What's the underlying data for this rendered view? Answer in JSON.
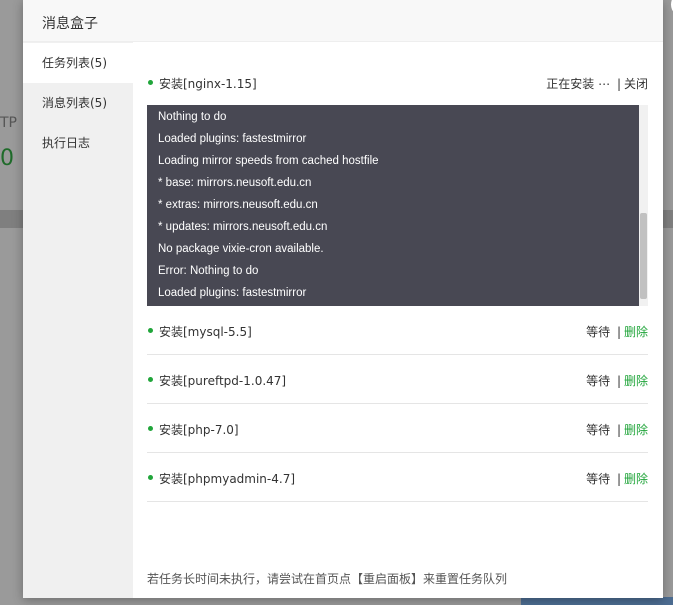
{
  "background": {
    "ftp_text": "TP",
    "number": "0"
  },
  "dialog": {
    "title": "消息盒子",
    "close_glyph": "×"
  },
  "sidebar": {
    "items": [
      {
        "label": "任务列表(5)"
      },
      {
        "label": "消息列表(5)"
      },
      {
        "label": "执行日志"
      }
    ]
  },
  "tasks": [
    {
      "name": "安装[nginx-1.15]",
      "status": "正在安装 ⋯",
      "action": "关闭"
    },
    {
      "name": "安装[mysql-5.5]",
      "status": "等待",
      "action": "删除"
    },
    {
      "name": "安装[pureftpd-1.0.47]",
      "status": "等待",
      "action": "删除"
    },
    {
      "name": "安装[php-7.0]",
      "status": "等待",
      "action": "删除"
    },
    {
      "name": "安装[phpmyadmin-4.7]",
      "status": "等待",
      "action": "删除"
    }
  ],
  "log_lines": [
    "Nothing to do",
    "Loaded plugins: fastestmirror",
    "Loading mirror speeds from cached hostfile",
    "* base: mirrors.neusoft.edu.cn",
    "* extras: mirrors.neusoft.edu.cn",
    "* updates: mirrors.neusoft.edu.cn",
    "No package vixie-cron available.",
    "Error: Nothing to do",
    "Loaded plugins: fastestmirror"
  ],
  "separator": "|",
  "footer_tip": "若任务长时间未执行，请尝试在首页点【重启面板】来重置任务队列",
  "colors": {
    "accent": "#20a53a",
    "log_bg": "#484853",
    "sidebar_bg": "#f0f0f0"
  }
}
